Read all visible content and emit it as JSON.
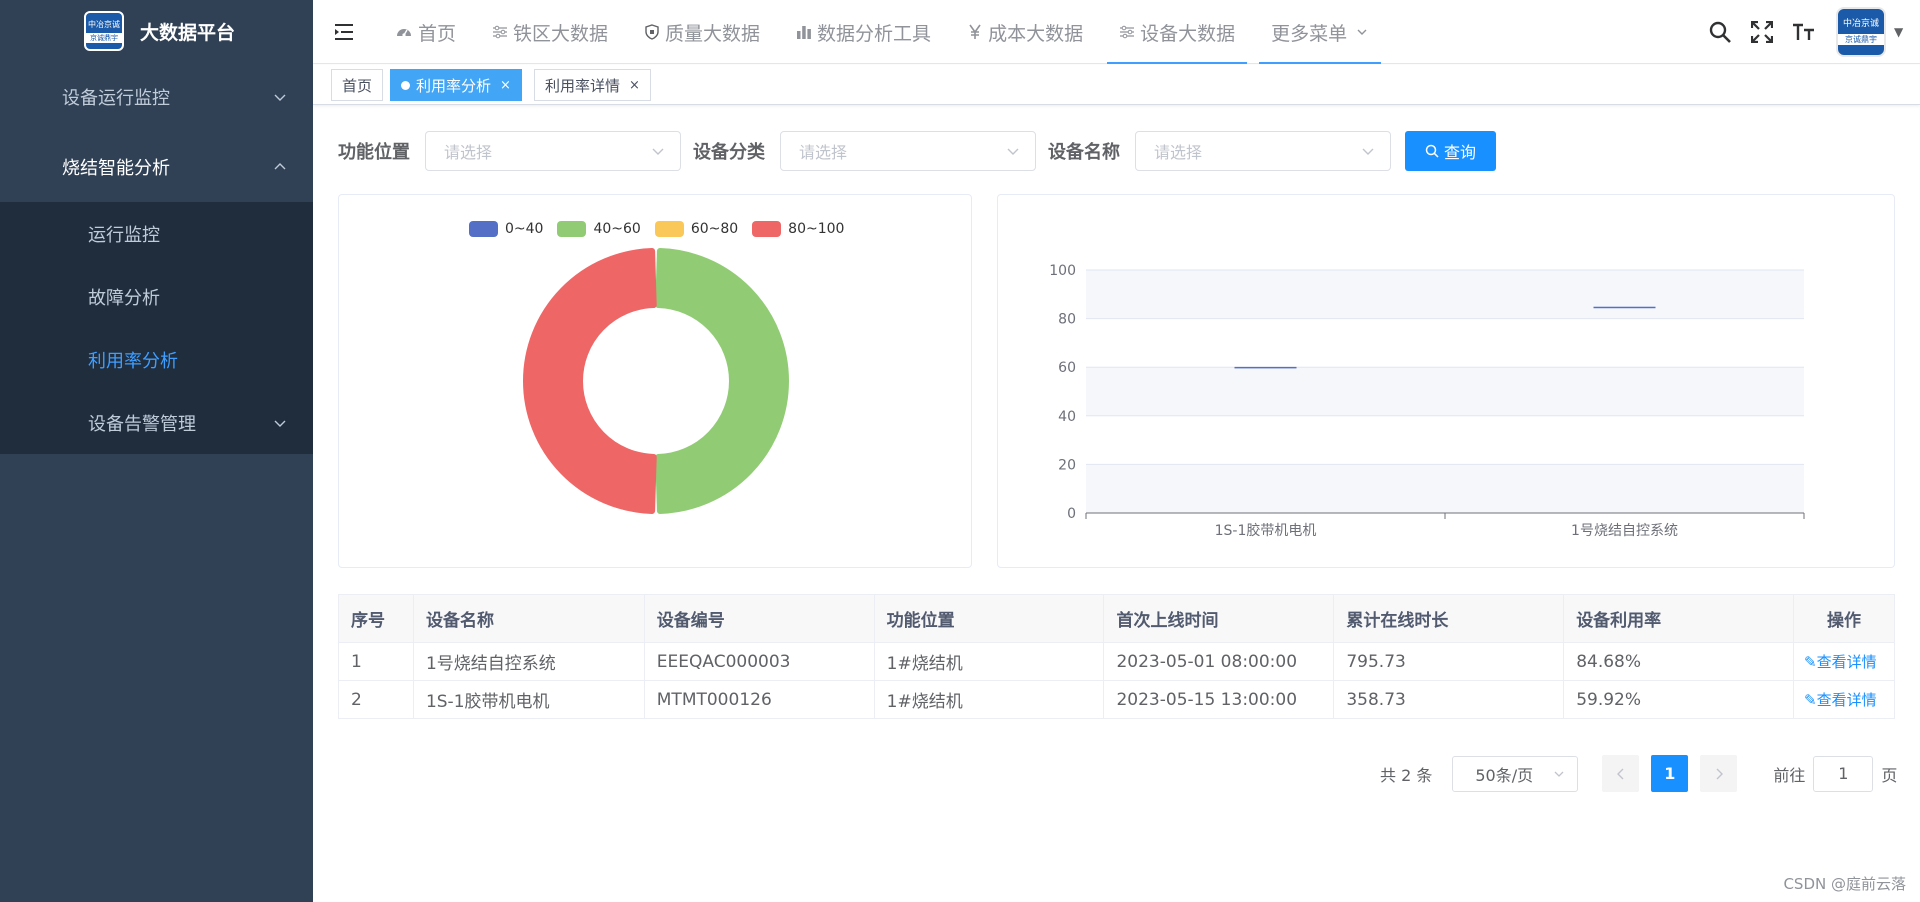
{
  "sidebar": {
    "logo": {
      "top": "中冶京诚",
      "bottom": "京诚鼎宇"
    },
    "title": "大数据平台",
    "menu": [
      {
        "label": "设备运行监控"
      },
      {
        "label": "烧结智能分析"
      }
    ],
    "submenu": [
      {
        "label": "运行监控"
      },
      {
        "label": "故障分析"
      },
      {
        "label": "利用率分析"
      },
      {
        "label": "设备告警管理"
      }
    ]
  },
  "topnav": {
    "items": [
      {
        "label": "首页",
        "icon": "dashboard-icon"
      },
      {
        "label": "铁区大数据",
        "icon": "sliders-icon"
      },
      {
        "label": "质量大数据",
        "icon": "shield-icon"
      },
      {
        "label": "数据分析工具",
        "icon": "bar-chart-icon"
      },
      {
        "label": "成本大数据",
        "icon": "yen-icon"
      },
      {
        "label": "设备大数据",
        "icon": "sliders-icon"
      },
      {
        "label": "更多菜单",
        "icon": "chevron-down-icon"
      }
    ],
    "avatar": {
      "top": "中冶京诚",
      "bottom": "京诚鼎宇"
    }
  },
  "tags": {
    "items": [
      {
        "label": "首页"
      },
      {
        "label": "利用率分析",
        "close": "×"
      },
      {
        "label": "利用率详情",
        "close": "×"
      }
    ]
  },
  "filters": {
    "location_label": "功能位置",
    "location_placeholder": "请选择",
    "category_label": "设备分类",
    "category_placeholder": "请选择",
    "name_label": "设备名称",
    "name_placeholder": "请选择",
    "query_button": "查询"
  },
  "chart_data": [
    {
      "type": "pie",
      "donut": true,
      "legend": [
        "0~40",
        "40~60",
        "60~80",
        "80~100"
      ],
      "legend_position": "top",
      "colors": [
        "#5470c6",
        "#91cc75",
        "#fac858",
        "#ee6666"
      ],
      "values": [
        0,
        1,
        0,
        1
      ]
    },
    {
      "type": "bar",
      "categories": [
        "1S-1胶带机电机",
        "1号烧结自控系统"
      ],
      "values": [
        59.92,
        84.68
      ],
      "ylim": [
        0,
        100
      ],
      "yticks": [
        0,
        20,
        40,
        60,
        80,
        100
      ],
      "grid": true,
      "color": "#5470c6"
    }
  ],
  "table": {
    "headers": [
      "序号",
      "设备名称",
      "设备编号",
      "功能位置",
      "首次上线时间",
      "累计在线时长",
      "设备利用率",
      "操作"
    ],
    "rows": [
      {
        "no": "1",
        "name": "1号烧结自控系统",
        "code": "EEEQAC000003",
        "location": "1#烧结机",
        "first_online": "2023-05-01 08:00:00",
        "online_hours": "795.73",
        "utilization": "84.68%",
        "action": "查看详情"
      },
      {
        "no": "2",
        "name": "1S-1胶带机电机",
        "code": "MTMT000126",
        "location": "1#烧结机",
        "first_online": "2023-05-15 13:00:00",
        "online_hours": "358.73",
        "utilization": "59.92%",
        "action": "查看详情"
      }
    ]
  },
  "pagination": {
    "total": "共 2 条",
    "page_size": "50条/页",
    "current": "1",
    "goto_prefix": "前往",
    "goto_value": "1",
    "goto_suffix": "页"
  },
  "watermark": "CSDN @庭前云落"
}
